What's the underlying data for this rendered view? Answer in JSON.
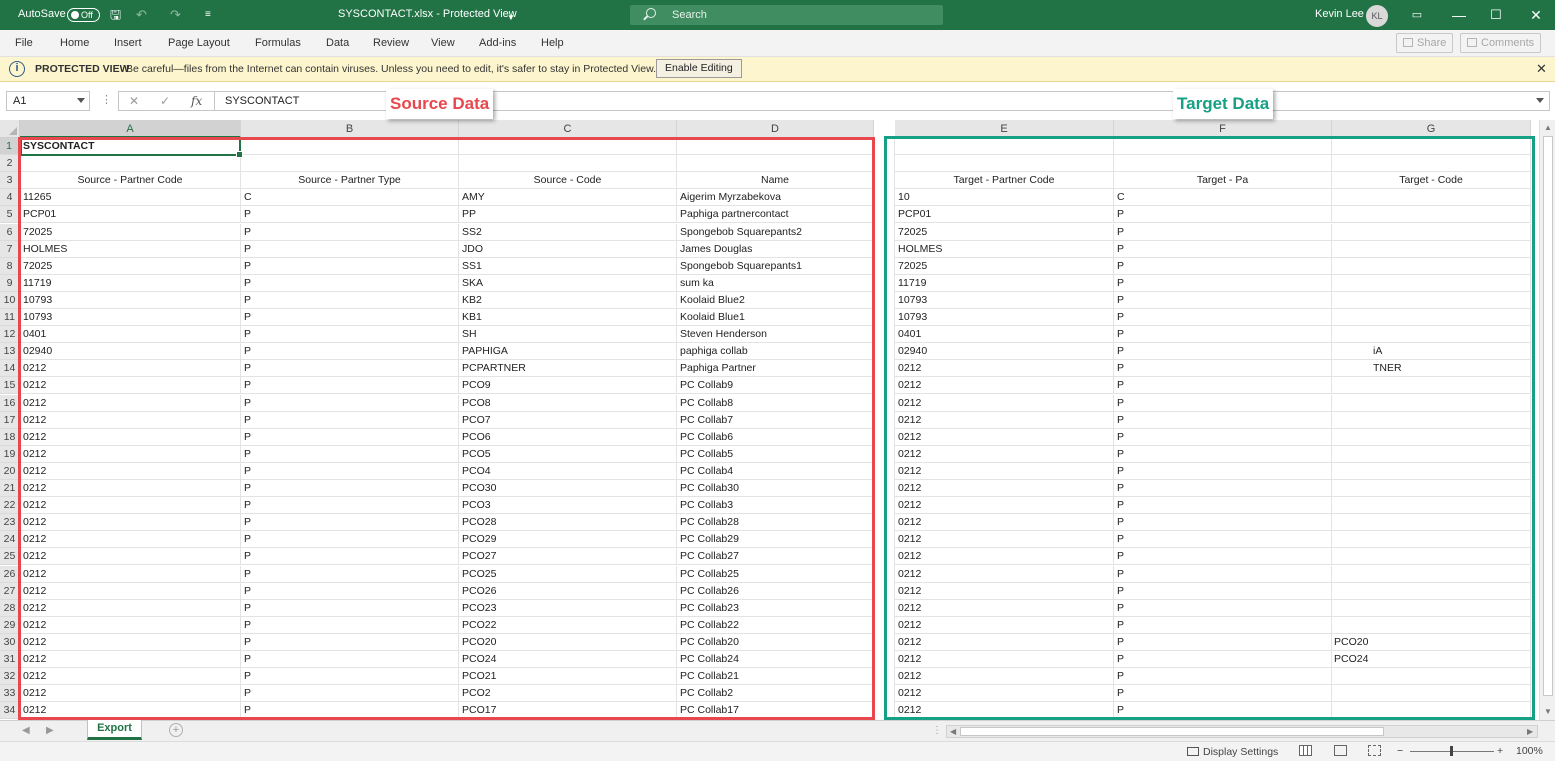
{
  "titlebar": {
    "autosave": "AutoSave",
    "toggle": "Off",
    "title": "SYSCONTACT.xlsx  -  Protected View",
    "search": "Search",
    "user": "Kevin Lee",
    "initials": "KL",
    "icons": [
      "save-icon",
      "undo-icon",
      "redo-icon",
      "customize-icon",
      "ribbon-display-icon",
      "minimize-icon",
      "maximize-icon",
      "close-icon"
    ]
  },
  "ribbon": {
    "tabs": [
      "File",
      "Home",
      "Insert",
      "Page Layout",
      "Formulas",
      "Data",
      "Review",
      "View",
      "Add-ins",
      "Help"
    ],
    "share": "Share",
    "comments": "Comments"
  },
  "protected_view": {
    "label": "PROTECTED VIEW",
    "message": "Be careful—files from the Internet can contain viruses. Unless you need to edit, it's safer to stay in Protected View.",
    "button": "Enable Editing",
    "close": "✕"
  },
  "formula_bar": {
    "name_box": "A1",
    "cancel": "✕",
    "enter": "✓",
    "fx": "fx",
    "content": "SYSCONTACT"
  },
  "annotations": {
    "source": {
      "label": "Source Data",
      "color": "#e8474d"
    },
    "target": {
      "label": "Target Data",
      "color": "#16a085"
    }
  },
  "sheet": {
    "columns": [
      "A",
      "B",
      "C",
      "D",
      "E",
      "F",
      "G"
    ],
    "title_cell": "SYSCONTACT",
    "headers": [
      "Source - Partner Code",
      "Source - Partner Type",
      "Source - Code",
      "Name",
      "Target - Partner Code",
      "Target - Pa",
      "Target - Code"
    ],
    "rows": [
      [
        "11265",
        "C",
        "AMY",
        "Aigerim Myrzabekova",
        "10",
        "C",
        ""
      ],
      [
        "PCP01",
        "P",
        "PP",
        "Paphiga partnercontact",
        "PCP01",
        "P",
        ""
      ],
      [
        "72025",
        "P",
        "SS2",
        "Spongebob Squarepants2",
        "72025",
        "P",
        ""
      ],
      [
        "HOLMES",
        "P",
        "JDO",
        "James Douglas",
        "HOLMES",
        "P",
        ""
      ],
      [
        "72025",
        "P",
        "SS1",
        "Spongebob Squarepants1",
        "72025",
        "P",
        ""
      ],
      [
        "11719",
        "P",
        "SKA",
        "sum ka",
        "11719",
        "P",
        ""
      ],
      [
        "10793",
        "P",
        "KB2",
        "Koolaid Blue2",
        "10793",
        "P",
        ""
      ],
      [
        "10793",
        "P",
        "KB1",
        "Koolaid Blue1",
        "10793",
        "P",
        ""
      ],
      [
        "0401",
        "P",
        "SH",
        "Steven Henderson",
        "0401",
        "P",
        ""
      ],
      [
        "02940",
        "P",
        "PAPHIGA",
        "paphiga collab",
        "02940",
        "P",
        "iA"
      ],
      [
        "0212",
        "P",
        "PCPARTNER",
        "Paphiga Partner",
        "0212",
        "P",
        "TNER"
      ],
      [
        "0212",
        "P",
        "PCO9",
        "PC Collab9",
        "0212",
        "P",
        ""
      ],
      [
        "0212",
        "P",
        "PCO8",
        "PC Collab8",
        "0212",
        "P",
        ""
      ],
      [
        "0212",
        "P",
        "PCO7",
        "PC Collab7",
        "0212",
        "P",
        ""
      ],
      [
        "0212",
        "P",
        "PCO6",
        "PC Collab6",
        "0212",
        "P",
        ""
      ],
      [
        "0212",
        "P",
        "PCO5",
        "PC Collab5",
        "0212",
        "P",
        ""
      ],
      [
        "0212",
        "P",
        "PCO4",
        "PC Collab4",
        "0212",
        "P",
        ""
      ],
      [
        "0212",
        "P",
        "PCO30",
        "PC Collab30",
        "0212",
        "P",
        ""
      ],
      [
        "0212",
        "P",
        "PCO3",
        "PC Collab3",
        "0212",
        "P",
        ""
      ],
      [
        "0212",
        "P",
        "PCO28",
        "PC Collab28",
        "0212",
        "P",
        ""
      ],
      [
        "0212",
        "P",
        "PCO29",
        "PC Collab29",
        "0212",
        "P",
        ""
      ],
      [
        "0212",
        "P",
        "PCO27",
        "PC Collab27",
        "0212",
        "P",
        ""
      ],
      [
        "0212",
        "P",
        "PCO25",
        "PC Collab25",
        "0212",
        "P",
        ""
      ],
      [
        "0212",
        "P",
        "PCO26",
        "PC Collab26",
        "0212",
        "P",
        ""
      ],
      [
        "0212",
        "P",
        "PCO23",
        "PC Collab23",
        "0212",
        "P",
        ""
      ],
      [
        "0212",
        "P",
        "PCO22",
        "PC Collab22",
        "0212",
        "P",
        ""
      ],
      [
        "0212",
        "P",
        "PCO20",
        "PC Collab20",
        "0212",
        "P",
        "PCO20"
      ],
      [
        "0212",
        "P",
        "PCO24",
        "PC Collab24",
        "0212",
        "P",
        "PCO24"
      ],
      [
        "0212",
        "P",
        "PCO21",
        "PC Collab21",
        "0212",
        "P",
        ""
      ],
      [
        "0212",
        "P",
        "PCO2",
        "PC Collab2",
        "0212",
        "P",
        ""
      ],
      [
        "0212",
        "P",
        "PCO17",
        "PC Collab17",
        "0212",
        "P",
        ""
      ]
    ],
    "tab": "Export"
  },
  "statusbar": {
    "display_settings": "Display Settings",
    "zoom_minus": "−",
    "zoom_plus": "+",
    "zoom": "100%",
    "zoom_fraction": 0.5
  }
}
